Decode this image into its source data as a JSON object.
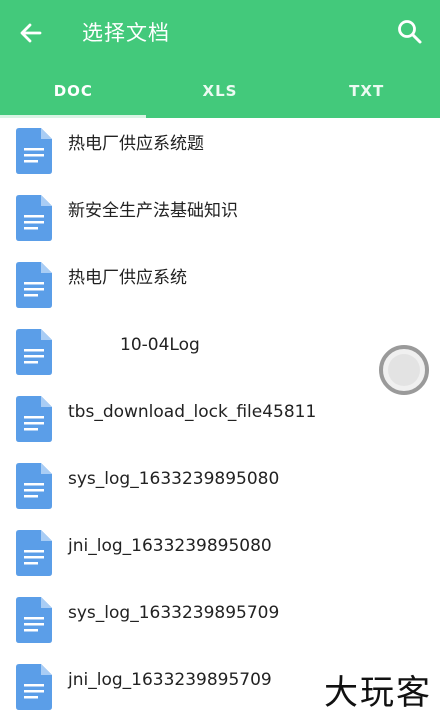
{
  "toolbar": {
    "title": "选择文档",
    "back_icon": "arrow-left-icon",
    "search_icon": "search-icon"
  },
  "tabs": [
    {
      "label": "DOC",
      "selected": true
    },
    {
      "label": "XLS",
      "selected": false
    },
    {
      "label": "TXT",
      "selected": false
    }
  ],
  "files": [
    {
      "name": "热电厂供应系统题"
    },
    {
      "name": "新安全生产法基础知识"
    },
    {
      "name": "热电厂供应系统"
    },
    {
      "name": "10-04Log"
    },
    {
      "name": "tbs_download_lock_file45811"
    },
    {
      "name": "sys_log_1633239895080"
    },
    {
      "name": "jni_log_1633239895080"
    },
    {
      "name": "sys_log_1633239895709"
    },
    {
      "name": "jni_log_1633239895709"
    }
  ],
  "file_icon": "document-icon",
  "watermark": "大玩客",
  "colors": {
    "accent": "#43c97b",
    "doc_icon": "#5b9ee8"
  }
}
